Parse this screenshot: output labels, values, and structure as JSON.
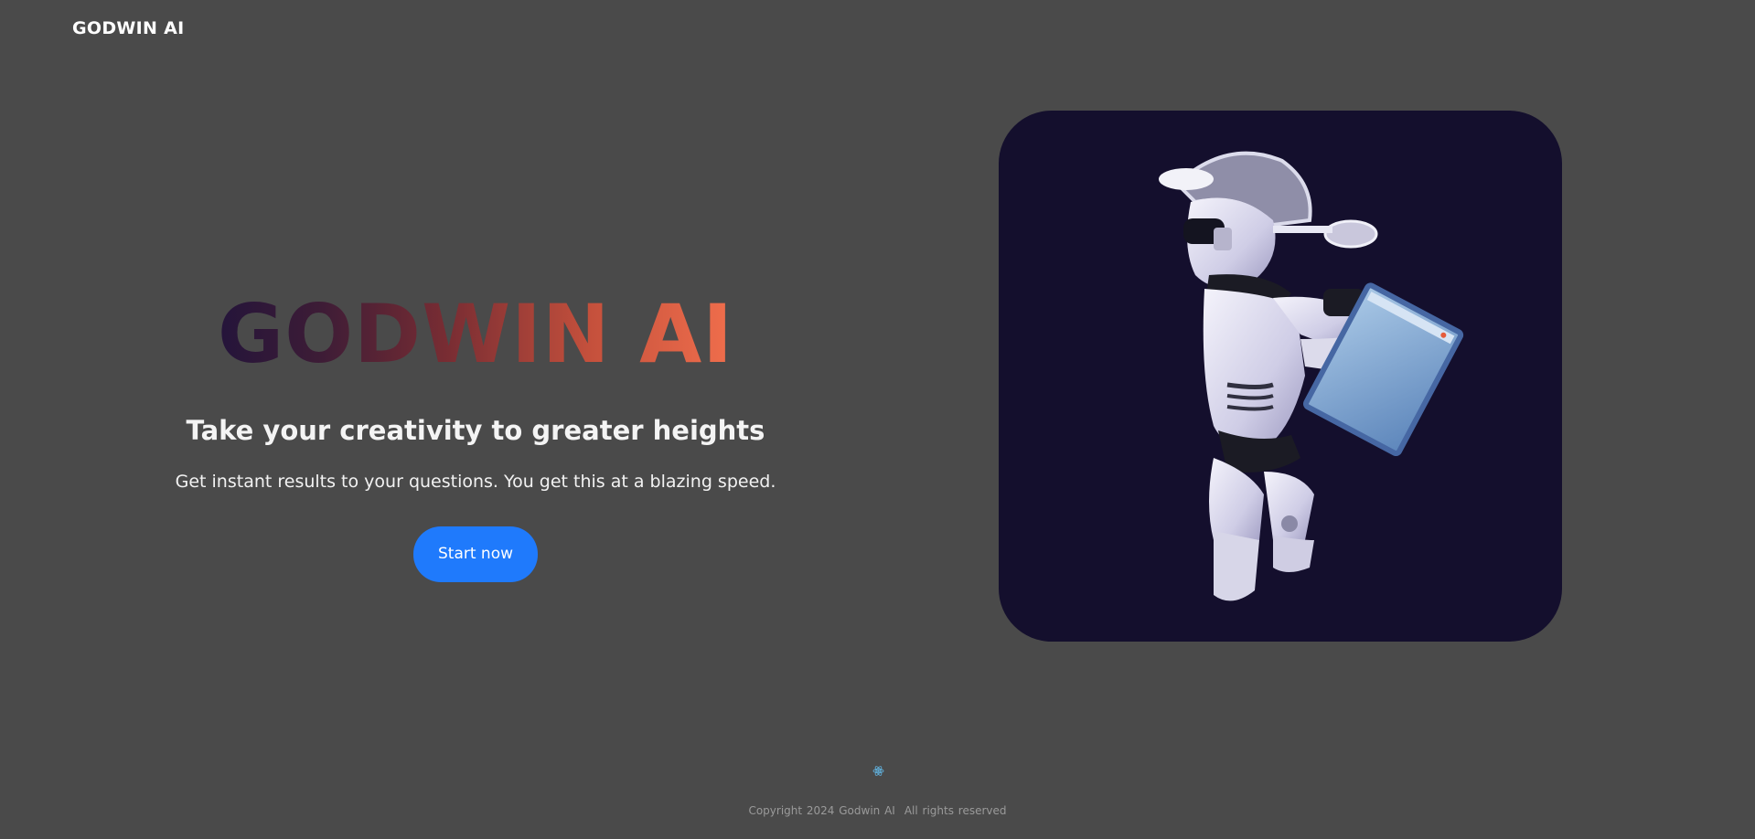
{
  "header": {
    "brand": "GODWIN AI"
  },
  "hero": {
    "title": "GODWIN AI",
    "subtitle": "Take your creativity to greater heights",
    "description": "Get instant results to your questions. You get this at a blazing speed.",
    "cta_label": "Start now"
  },
  "footer": {
    "copyright": "Copyright 2024 Godwin AI",
    "rights": "All rights reserved"
  },
  "colors": {
    "background": "#4a4a4a",
    "cta": "#1f7afc",
    "image_bg": "#140f2d",
    "title_gradient_start": "#24143a",
    "title_gradient_end": "#f06e4c"
  }
}
